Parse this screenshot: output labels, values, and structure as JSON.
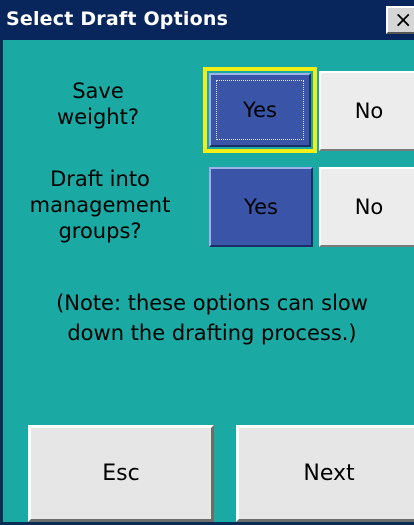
{
  "window": {
    "title": "Select Draft Options",
    "close_glyph": "×"
  },
  "options": [
    {
      "label": "Save weight?",
      "label_lines": [
        "Save",
        "weight?"
      ],
      "yes_label": "Yes",
      "no_label": "No",
      "selected": "Yes",
      "focused": true
    },
    {
      "label": "Draft into management groups?",
      "label_lines": [
        "Draft into",
        "management",
        "groups?"
      ],
      "yes_label": "Yes",
      "no_label": "No",
      "selected": "Yes",
      "focused": false
    }
  ],
  "note": {
    "lines": [
      "(Note: these options can slow",
      "down the drafting process.)"
    ]
  },
  "footer": {
    "esc_label": "Esc",
    "next_label": "Next"
  },
  "colors": {
    "background": "#1aa9a3",
    "titlebar": "#08255c",
    "selected_button": "#3a55a8",
    "focus_ring": "#f2ee17"
  }
}
